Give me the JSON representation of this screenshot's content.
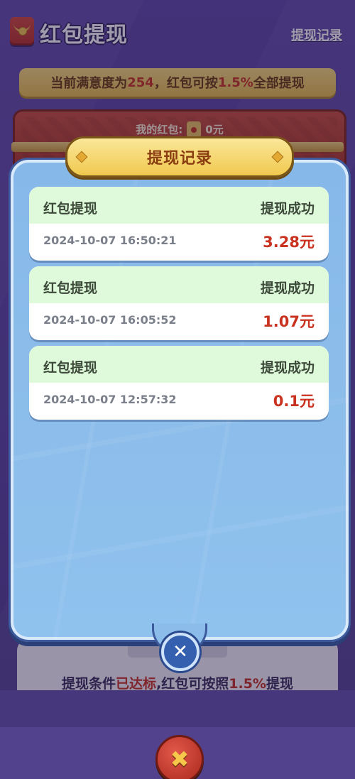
{
  "header": {
    "title": "红包提现",
    "records_link": "提现记录"
  },
  "banner": {
    "prefix": "当前满意度为",
    "satisfaction": "254",
    "middle": "，红包可按",
    "rate": "1.5%",
    "suffix": "全部提现"
  },
  "redpack": {
    "label": "我的红包:",
    "amount": "0元"
  },
  "withdraw_note": {
    "prefix": "提现条件",
    "reached": "已达标",
    "middle": ",红包可按照",
    "rate": "1.5%",
    "suffix": "提现"
  },
  "modal": {
    "title": "提现记录",
    "records": [
      {
        "type": "红包提现",
        "status": "提现成功",
        "time": "2024-10-07 16:50:21",
        "amount": "3.28元"
      },
      {
        "type": "红包提现",
        "status": "提现成功",
        "time": "2024-10-07 16:05:52",
        "amount": "1.07元"
      },
      {
        "type": "红包提现",
        "status": "提现成功",
        "time": "2024-10-07 12:57:32",
        "amount": "0.1元"
      }
    ]
  },
  "icons": {
    "title_icon": "red-envelope-icon",
    "modal_close": "close-icon",
    "page_close": "close-icon"
  },
  "colors": {
    "accent_red": "#c9321f",
    "record_header_green": "#dffadb",
    "modal_blue": "#86b8ea",
    "gold": "#f0c94e"
  }
}
